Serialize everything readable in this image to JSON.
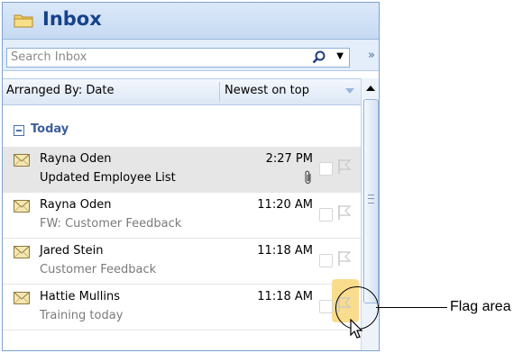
{
  "pane": {
    "title": "Inbox",
    "folder_icon": "folder-icon"
  },
  "search": {
    "placeholder": "Search Inbox",
    "icon": "search-icon"
  },
  "arrange": {
    "label": "Arranged By: Date",
    "sort": "Newest on top"
  },
  "group": {
    "label": "Today",
    "expanded": true
  },
  "messages": [
    {
      "sender": "Rayna Oden",
      "subject": "Updated Employee List",
      "time": "2:27 PM",
      "attachment": true,
      "selected": true,
      "unread": false
    },
    {
      "sender": "Rayna Oden",
      "subject": "FW: Customer Feedback",
      "time": "11:20 AM",
      "attachment": false,
      "selected": false,
      "unread": false
    },
    {
      "sender": "Jared Stein",
      "subject": "Customer Feedback",
      "time": "11:18 AM",
      "attachment": false,
      "selected": false,
      "unread": false
    },
    {
      "sender": "Hattie Mullins",
      "subject": "Training today",
      "time": "11:18 AM",
      "attachment": false,
      "selected": false,
      "unread": false
    }
  ],
  "callout": {
    "label": "Flag area"
  },
  "colors": {
    "accent": "#15428b",
    "header_bg": "#c6daf3",
    "flag_highlight": "#f9dc8e"
  }
}
